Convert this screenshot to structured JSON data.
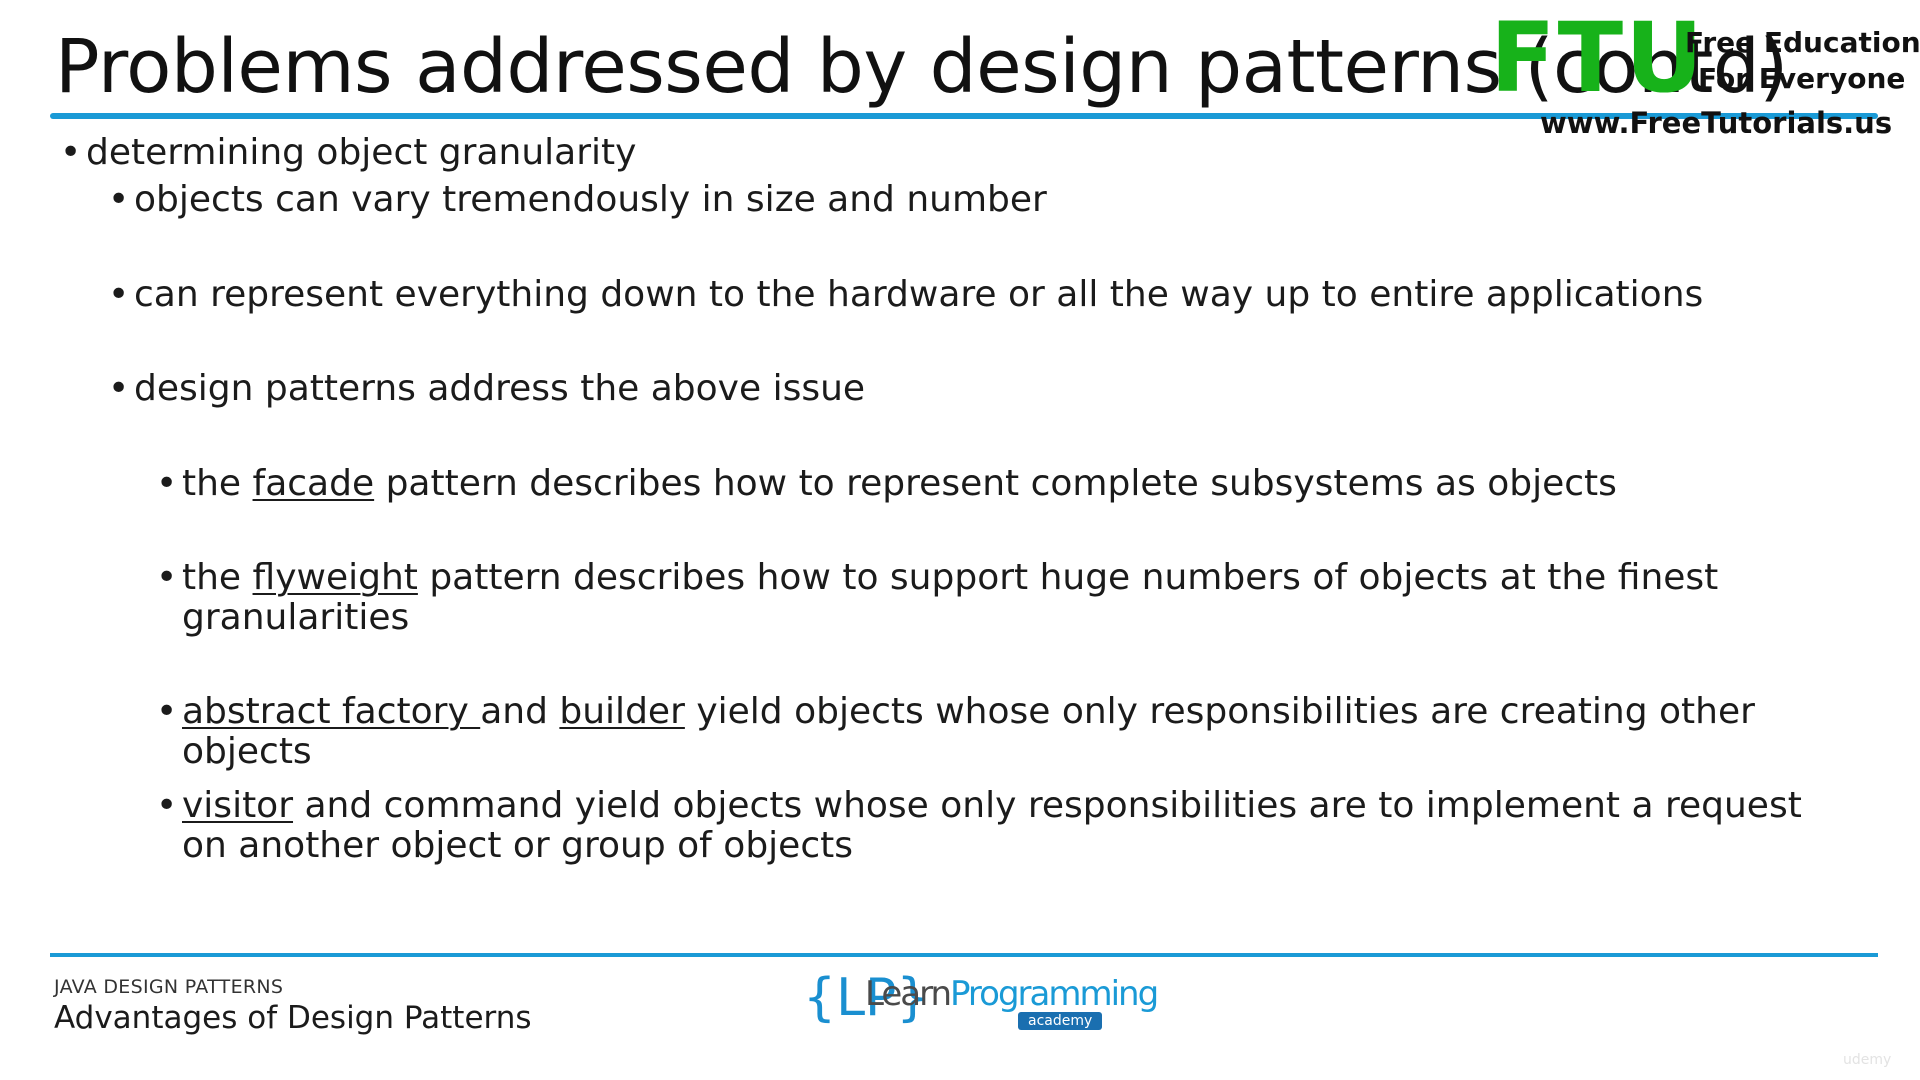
{
  "title": "Problems addressed by design patterns (contd)",
  "watermark": {
    "letters": "FTU",
    "line1": "Free Education",
    "line2": "For Everyone",
    "url": "www.FreeTutorials.us",
    "brand_color": "#17b21a"
  },
  "bullets": [
    {
      "level": 1,
      "segments": [
        {
          "text": "determining object granularity"
        }
      ]
    },
    {
      "level": 2,
      "segments": [
        {
          "text": "objects can vary tremendously in size and number"
        }
      ]
    },
    {
      "level": 2,
      "segments": [
        {
          "text": "can represent everything down to the hardware or all the way up to entire applications"
        }
      ]
    },
    {
      "level": 2,
      "segments": [
        {
          "text": "design patterns address the above issue"
        }
      ]
    },
    {
      "level": 3,
      "segments": [
        {
          "text": "the "
        },
        {
          "text": "facade",
          "underline": true
        },
        {
          "text": " pattern describes how to represent complete subsystems as objects"
        }
      ]
    },
    {
      "level": 3,
      "segments": [
        {
          "text": "the "
        },
        {
          "text": "flyweight",
          "underline": true
        },
        {
          "text": " pattern describes how to support huge numbers of objects at the finest granularities"
        }
      ]
    },
    {
      "level": 3,
      "segments": [
        {
          "text": "abstract factory ",
          "underline": true
        },
        {
          "text": "and "
        },
        {
          "text": "builder",
          "underline": true
        },
        {
          "text": " yield objects whose only responsibilities are creating other objects"
        }
      ]
    },
    {
      "level": 3,
      "segments": [
        {
          "text": "visitor",
          "underline": true
        },
        {
          "text": " and command yield objects whose only responsibilities are to implement a request on another object or group of objects"
        }
      ]
    }
  ],
  "footer": {
    "course": "JAVA DESIGN PATTERNS",
    "lecture": "Advantages of Design Patterns",
    "logo": {
      "brace_text": "{LP}",
      "learn": "Learn",
      "programming": "Programming",
      "tag": "academy"
    },
    "corner_mark": "udemy"
  },
  "colors": {
    "accent": "#1a9ad6",
    "text": "#1b1b1b"
  }
}
